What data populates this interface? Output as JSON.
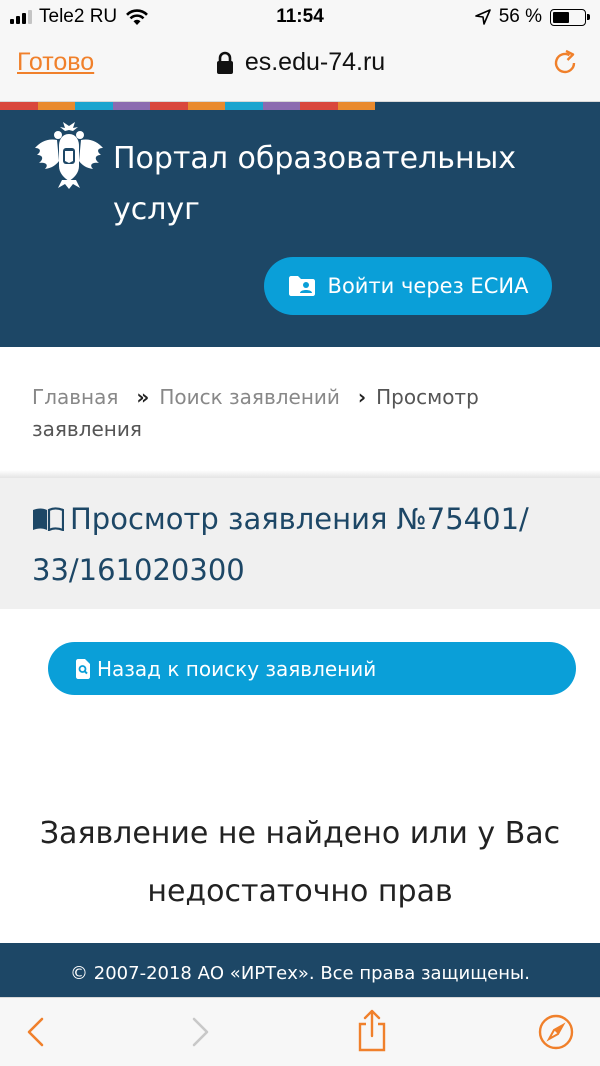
{
  "status_bar": {
    "carrier": "Tele2 RU",
    "time": "11:54",
    "battery_percent": "56 %",
    "battery_level": 0.56
  },
  "browser": {
    "done_label": "Готово",
    "url": "es.edu-74.ru",
    "accent_color": "#f0802b"
  },
  "header": {
    "title": "Портал образовательных услуг",
    "login_button": "Войти через ЕСИА",
    "stripe_colors": [
      "#d9473c",
      "#e98a2e",
      "#1aa4cf",
      "#8b6bb0",
      "#d9473c",
      "#e98a2e",
      "#1aa4cf",
      "#8b6bb0",
      "#d9473c",
      "#e98a2e"
    ],
    "background_color": "#1d4766",
    "button_color": "#0a9fd8"
  },
  "breadcrumb": {
    "items": [
      "Главная",
      "Поиск заявлений",
      "Просмотр заявления"
    ],
    "separators": [
      "»",
      "›"
    ]
  },
  "page": {
    "title": "Просмотр заявления №75401/ 33/161020300",
    "back_button": "Назад к поиску заявлений",
    "message": "Заявление не найдено или у Вас недостаточно прав"
  },
  "footer": {
    "copyright": "© 2007-2018 АО «ИРТех». Все права защищены."
  },
  "toolbar": {
    "icons": [
      "back-arrow-icon",
      "forward-arrow-icon",
      "share-icon",
      "compass-icon"
    ]
  }
}
